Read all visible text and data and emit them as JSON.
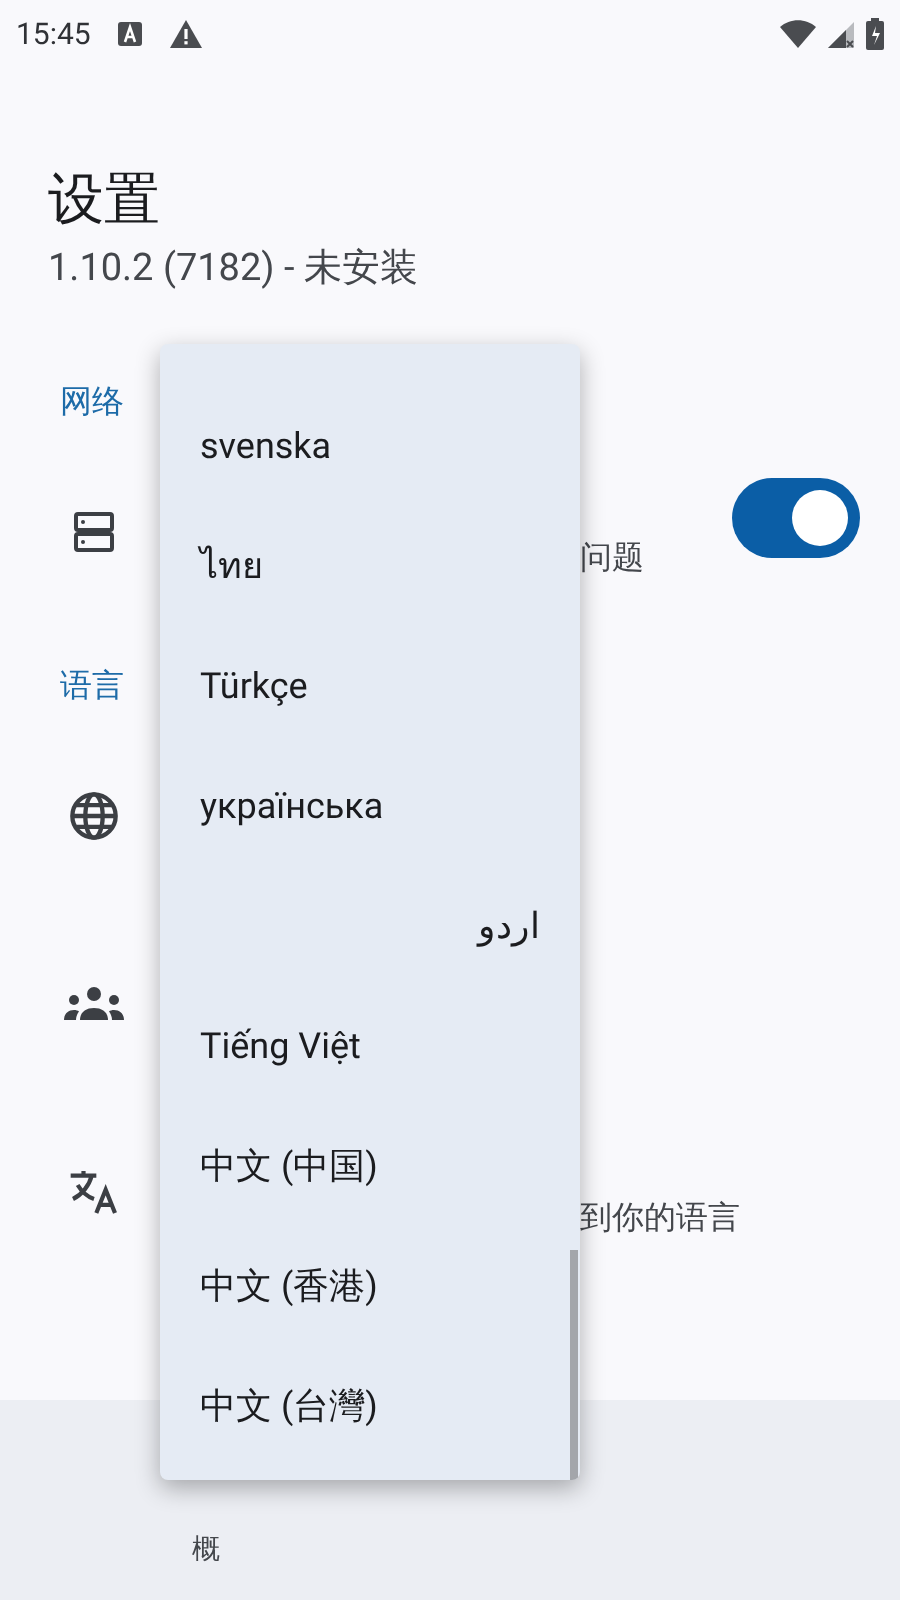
{
  "status_bar": {
    "time": "15:45"
  },
  "header": {
    "title": "设置",
    "subtitle": "1.10.2 (7182) - 未安装"
  },
  "sections": [
    {
      "header": "网络",
      "rows": [
        {
          "kind": "server",
          "text": "问题",
          "on": true
        }
      ]
    },
    {
      "header": "语言",
      "rows": [
        {
          "kind": "globe"
        },
        {
          "kind": "people"
        },
        {
          "kind": "translate",
          "text": "到你的语言"
        }
      ]
    }
  ],
  "bottom_nav": {
    "items": [
      {
        "label": "概"
      }
    ]
  },
  "language_menu": {
    "items": [
      {
        "label": "svenska"
      },
      {
        "label": "ไทย"
      },
      {
        "label": "Türkçe"
      },
      {
        "label": "українська"
      },
      {
        "label": "اردو"
      },
      {
        "label": "Tiếng Việt"
      },
      {
        "label": "中文 (中国)"
      },
      {
        "label": "中文 (香港)"
      },
      {
        "label": "中文 (台灣)"
      }
    ]
  }
}
